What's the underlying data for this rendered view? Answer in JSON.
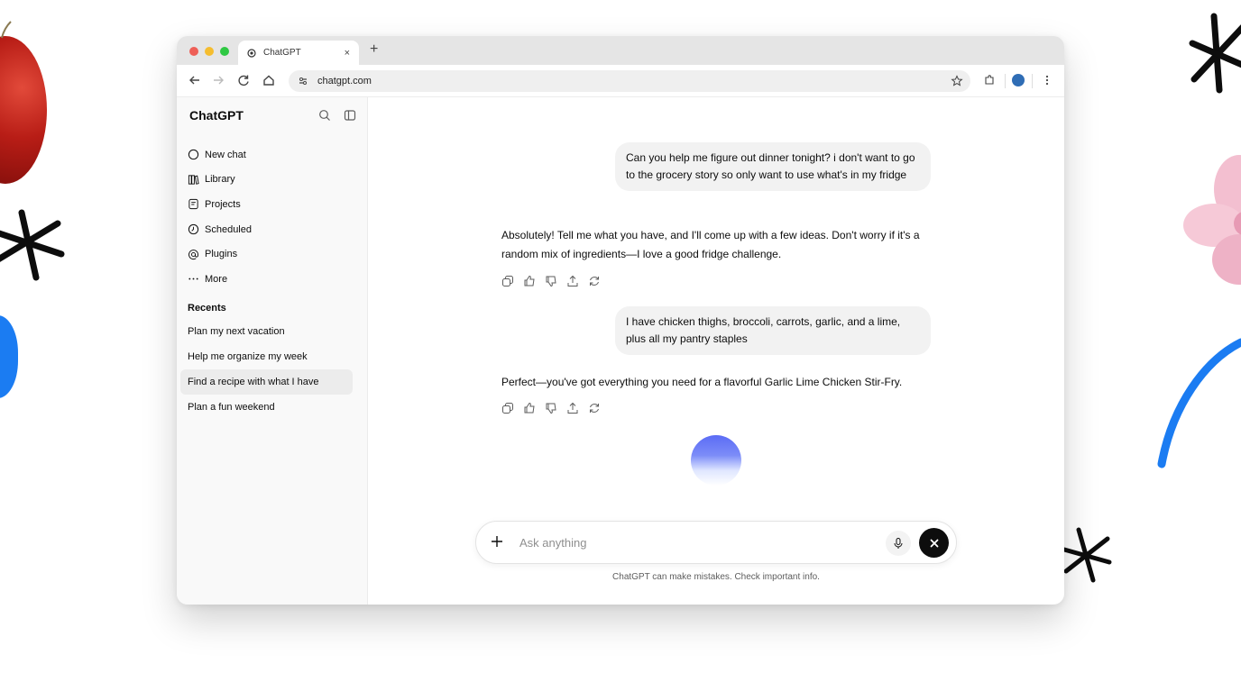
{
  "browser": {
    "tab_title": "ChatGPT",
    "tab_close": "×",
    "new_tab": "+",
    "url": "chatgpt.com"
  },
  "sidebar": {
    "title": "ChatGPT",
    "menu": [
      {
        "label": "New chat",
        "icon": "new-chat-icon"
      },
      {
        "label": "Library",
        "icon": "library-icon"
      },
      {
        "label": "Projects",
        "icon": "projects-icon"
      },
      {
        "label": "Scheduled",
        "icon": "clock-icon"
      },
      {
        "label": "Plugins",
        "icon": "at-icon"
      },
      {
        "label": "More",
        "icon": "more-icon"
      }
    ],
    "recents_label": "Recents",
    "recents": [
      "Plan my next vacation",
      "Help me organize my week",
      "Find a recipe with what I have",
      "Plan a fun weekend"
    ]
  },
  "conversation": {
    "user_1": "Can you help me figure out dinner tonight? i don't want to go to the grocery story so only want to use what's in my fridge",
    "assistant_1": "Absolutely! Tell me what you have, and I'll come up with a few ideas. Don't worry if it's a random mix of ingredients—I love a good fridge challenge.",
    "user_2": "I have chicken thighs, broccoli, carrots, garlic, and a lime, plus all my pantry staples",
    "assistant_2": "Perfect—you've got everything you need for a flavorful Garlic Lime Chicken Stir-Fry."
  },
  "composer": {
    "placeholder": "Ask anything",
    "disclaimer": "ChatGPT can make mistakes. Check important info."
  },
  "colors": {
    "accent_blue": "#1b7cf2",
    "profile": "#2f6db5",
    "stop_button": "#0d0d0d"
  }
}
